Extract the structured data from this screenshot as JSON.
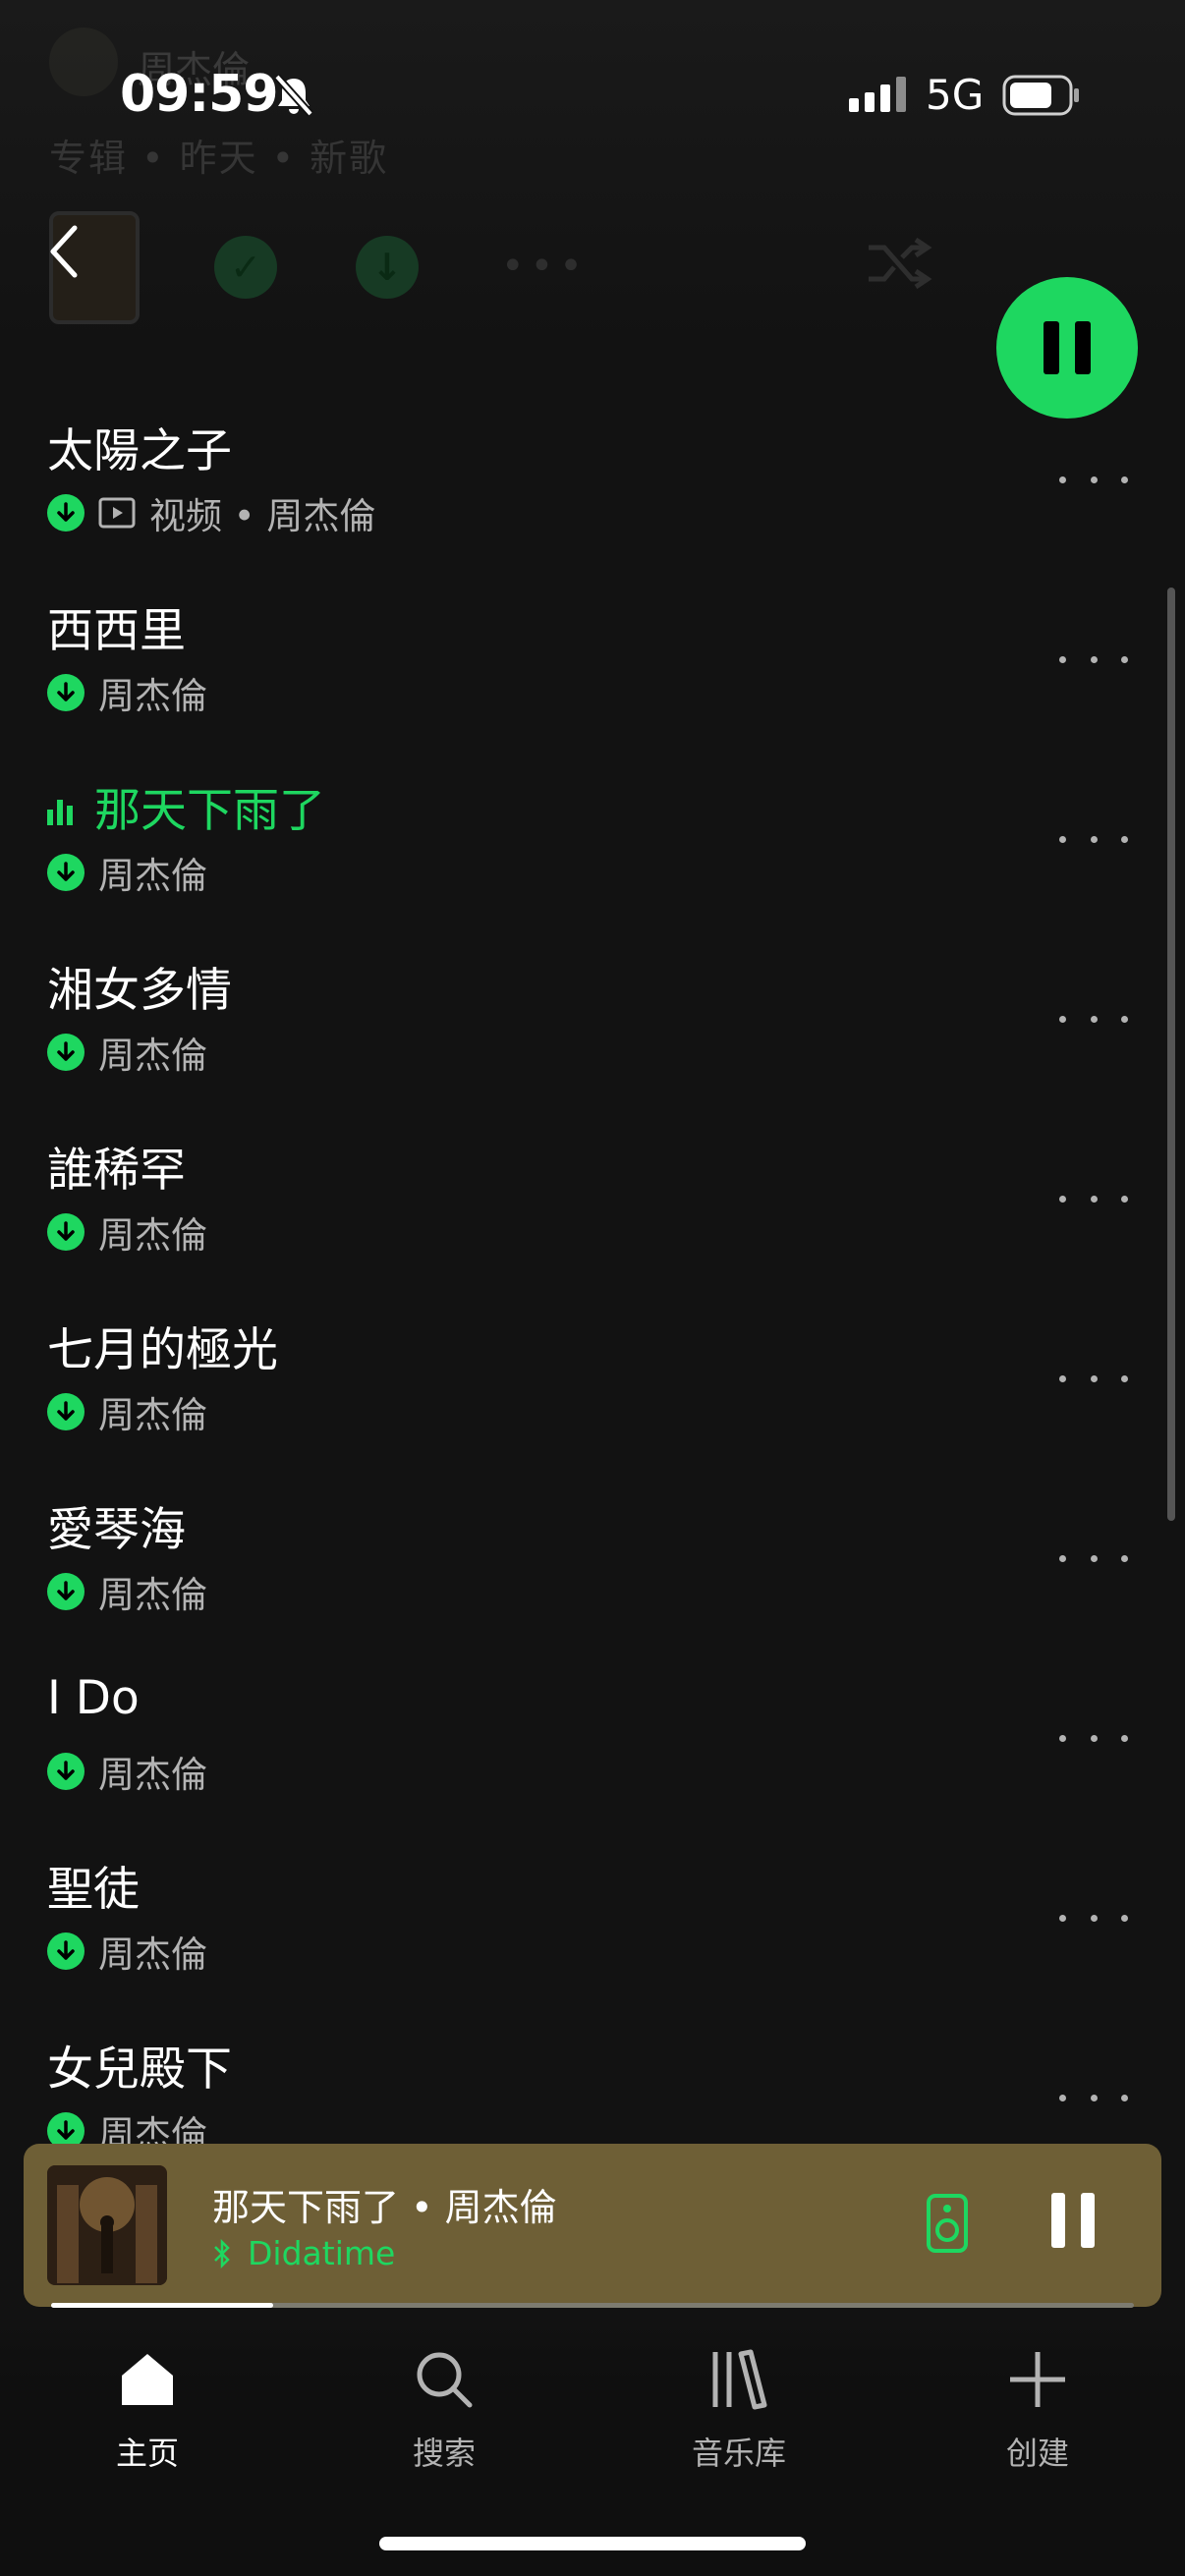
{
  "status_bar": {
    "time": "09:59",
    "network": "5G",
    "battery_level": 0.75
  },
  "header": {
    "artist": "周杰倫",
    "meta": "专辑 • 昨天 • 新歌"
  },
  "tracks": [
    {
      "title": "太陽之子",
      "artist": "视频 • 周杰倫",
      "downloaded": true,
      "video": true,
      "playing": false
    },
    {
      "title": "西西里",
      "artist": "周杰倫",
      "downloaded": true,
      "video": false,
      "playing": false
    },
    {
      "title": "那天下雨了",
      "artist": "周杰倫",
      "downloaded": true,
      "video": false,
      "playing": true
    },
    {
      "title": "湘女多情",
      "artist": "周杰倫",
      "downloaded": true,
      "video": false,
      "playing": false
    },
    {
      "title": "誰稀罕",
      "artist": "周杰倫",
      "downloaded": true,
      "video": false,
      "playing": false
    },
    {
      "title": "七月的極光",
      "artist": "周杰倫",
      "downloaded": true,
      "video": false,
      "playing": false
    },
    {
      "title": "愛琴海",
      "artist": "周杰倫",
      "downloaded": true,
      "video": false,
      "playing": false
    },
    {
      "title": "I Do",
      "artist": "周杰倫",
      "downloaded": true,
      "video": false,
      "playing": false
    },
    {
      "title": "聖徒",
      "artist": "周杰倫",
      "downloaded": true,
      "video": false,
      "playing": false
    },
    {
      "title": "女兒殿下",
      "artist": "周杰倫",
      "downloaded": true,
      "video": false,
      "playing": false
    }
  ],
  "mini_player": {
    "title": "那天下雨了 • 周杰倫",
    "device": "Didatime",
    "progress": 0.205
  },
  "nav": {
    "items": [
      {
        "label": "主页",
        "icon": "home-icon",
        "active": true
      },
      {
        "label": "搜索",
        "icon": "search-icon",
        "active": false
      },
      {
        "label": "音乐库",
        "icon": "library-icon",
        "active": false
      },
      {
        "label": "创建",
        "icon": "plus-icon",
        "active": false
      }
    ]
  },
  "colors": {
    "accent": "#1ed760",
    "background": "#121212",
    "mini_player_bg": "#6e5f36"
  }
}
